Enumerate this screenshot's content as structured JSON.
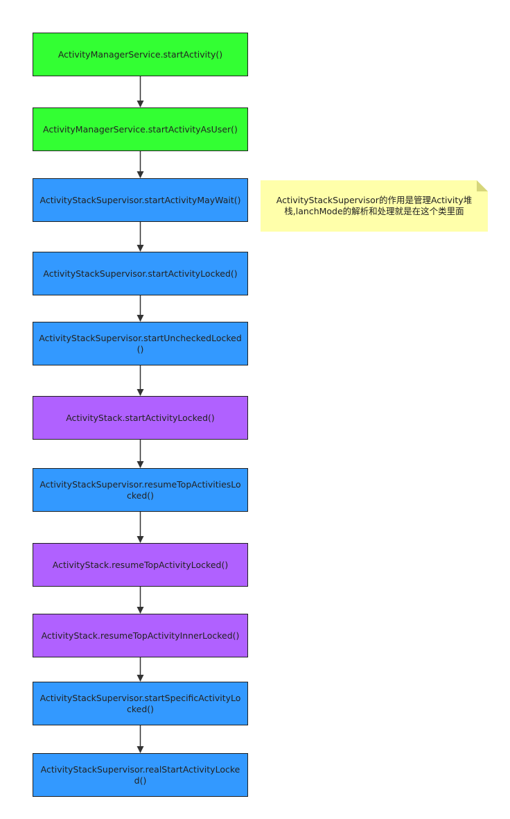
{
  "nodes": [
    {
      "label": "ActivityManagerService.startActivity()",
      "color": "#33ff33"
    },
    {
      "label": "ActivityManagerService.startActivityAsUser()",
      "color": "#33ff33"
    },
    {
      "label": "ActivityStackSupervisor.startActivityMayWait()",
      "color": "#3399ff"
    },
    {
      "label": "ActivityStackSupervisor.startActivityLocked()",
      "color": "#3399ff"
    },
    {
      "label": "ActivityStackSupervisor.startUncheckedLocked()",
      "color": "#3399ff"
    },
    {
      "label": "ActivityStack.startActivityLocked()",
      "color": "#b061ff"
    },
    {
      "label": "ActivityStackSupervisor.resumeTopActivitiesLocked()",
      "color": "#3399ff"
    },
    {
      "label": "ActivityStack.resumeTopActivityLocked()",
      "color": "#b061ff"
    },
    {
      "label": "ActivityStack.resumeTopActivityInnerLocked()",
      "color": "#b061ff"
    },
    {
      "label": "ActivityStackSupervisor.startSpecificActivityLocked()",
      "color": "#3399ff"
    },
    {
      "label": "ActivityStackSupervisor.realStartActivityLocked()",
      "color": "#3399ff"
    }
  ],
  "note": {
    "text": "ActivityStackSupervisor的作用是管理Activity堆栈,lanchMode的解析和处理就是在这个类里面",
    "color": "#ffffaa"
  }
}
